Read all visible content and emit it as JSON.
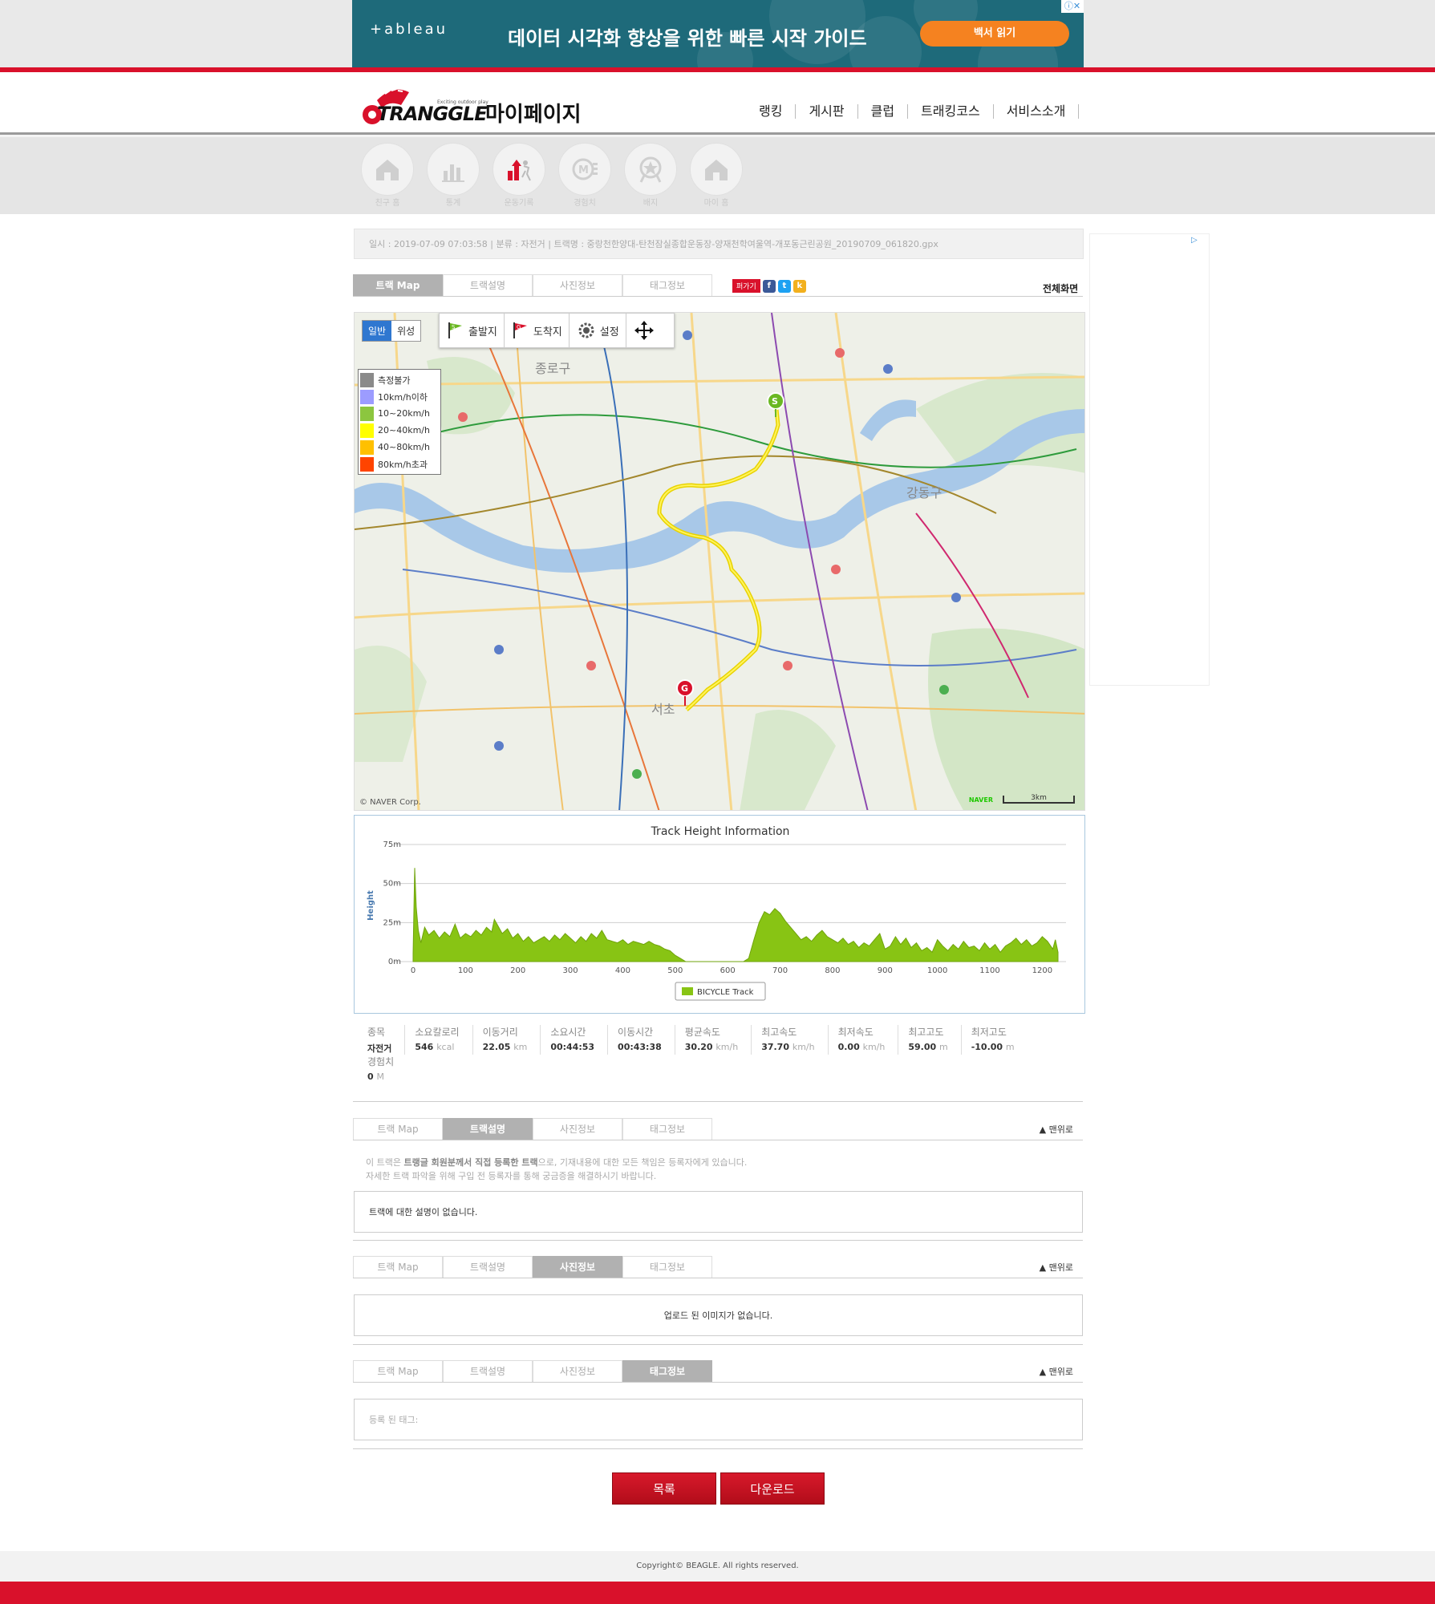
{
  "ad": {
    "brand": "+ableau",
    "headline": "데이터 시각화 향상을 위한 빠른 시작 가이드",
    "button": "백서 읽기"
  },
  "header": {
    "logo_text": "TRANGGLE",
    "slogan": "Exciting outdoor play",
    "page_title": "마이페이지",
    "nav": [
      "랭킹",
      "게시판",
      "클럽",
      "트래킹코스",
      "서비스소개"
    ]
  },
  "subnav": [
    "친구 홈",
    "통계",
    "운동기록",
    "경험치",
    "배지",
    "마이 홈"
  ],
  "info": "일시 : 2019-07-09 07:03:58   |   분류 : 자전거   |   트랙명 : 중랑천한양대-탄천잠실종합운동장-양재천학여울역-개포동근린공원_20190709_061820.gpx",
  "tabs": [
    "트랙 Map",
    "트랙설명",
    "사진정보",
    "태그정보"
  ],
  "share_label": "퍼가기",
  "fullscreen": "전체화면",
  "to_top": "맨위로",
  "map": {
    "toggle": [
      "일반",
      "위성"
    ],
    "tools": [
      "출발지",
      "도착지",
      "설정"
    ],
    "legend": [
      {
        "label": "측정불가",
        "color": "#8a8a8a"
      },
      {
        "label": "10km/h이하",
        "color": "#9c9cff"
      },
      {
        "label": "10~20km/h",
        "color": "#8cc63f"
      },
      {
        "label": "20~40km/h",
        "color": "#ffff00"
      },
      {
        "label": "40~80km/h",
        "color": "#ffc000"
      },
      {
        "label": "80km/h초과",
        "color": "#ff4400"
      }
    ],
    "labels": [
      "종로구",
      "강동구",
      "서초"
    ],
    "copyright": "© NAVER Corp.",
    "naver": "NAVER",
    "scale": "3km"
  },
  "chart_data": {
    "type": "area",
    "title": "Track Height Information",
    "ylabel": "Height",
    "xlabel": "",
    "xlim": [
      0,
      1230
    ],
    "ylim": [
      0,
      75
    ],
    "x_ticks": [
      0,
      100,
      200,
      300,
      400,
      500,
      600,
      700,
      800,
      900,
      1000,
      1100,
      1200
    ],
    "y_ticks": [
      "0m",
      "25m",
      "50m",
      "75m"
    ],
    "series": [
      {
        "name": "BICYCLE Track",
        "color": "#88c414",
        "points": [
          [
            0,
            5
          ],
          [
            3,
            60
          ],
          [
            6,
            35
          ],
          [
            10,
            20
          ],
          [
            15,
            12
          ],
          [
            22,
            22
          ],
          [
            30,
            17
          ],
          [
            40,
            20
          ],
          [
            50,
            15
          ],
          [
            60,
            19
          ],
          [
            70,
            16
          ],
          [
            80,
            24
          ],
          [
            90,
            15
          ],
          [
            100,
            18
          ],
          [
            110,
            16
          ],
          [
            120,
            20
          ],
          [
            130,
            17
          ],
          [
            140,
            22
          ],
          [
            150,
            19
          ],
          [
            155,
            27
          ],
          [
            160,
            24
          ],
          [
            170,
            18
          ],
          [
            180,
            21
          ],
          [
            190,
            15
          ],
          [
            200,
            18
          ],
          [
            210,
            13
          ],
          [
            220,
            16
          ],
          [
            230,
            12
          ],
          [
            240,
            14
          ],
          [
            250,
            16
          ],
          [
            260,
            13
          ],
          [
            270,
            17
          ],
          [
            280,
            14
          ],
          [
            290,
            18
          ],
          [
            300,
            15
          ],
          [
            310,
            12
          ],
          [
            320,
            16
          ],
          [
            330,
            13
          ],
          [
            340,
            18
          ],
          [
            350,
            15
          ],
          [
            360,
            20
          ],
          [
            370,
            14
          ],
          [
            380,
            13
          ],
          [
            390,
            12
          ],
          [
            400,
            14
          ],
          [
            410,
            11
          ],
          [
            420,
            13
          ],
          [
            430,
            12
          ],
          [
            440,
            11
          ],
          [
            450,
            13
          ],
          [
            460,
            11
          ],
          [
            470,
            10
          ],
          [
            480,
            8
          ],
          [
            490,
            7
          ],
          [
            500,
            4
          ],
          [
            510,
            2
          ],
          [
            520,
            0
          ],
          [
            530,
            -2
          ],
          [
            540,
            -4
          ],
          [
            550,
            -5
          ],
          [
            560,
            -6
          ],
          [
            570,
            -7
          ],
          [
            580,
            -8
          ],
          [
            590,
            -9
          ],
          [
            600,
            -10
          ],
          [
            610,
            -10
          ],
          [
            620,
            -8
          ],
          [
            630,
            -4
          ],
          [
            640,
            2
          ],
          [
            650,
            14
          ],
          [
            660,
            25
          ],
          [
            670,
            32
          ],
          [
            680,
            30
          ],
          [
            690,
            34
          ],
          [
            700,
            31
          ],
          [
            710,
            26
          ],
          [
            720,
            22
          ],
          [
            730,
            18
          ],
          [
            740,
            14
          ],
          [
            750,
            16
          ],
          [
            760,
            13
          ],
          [
            770,
            17
          ],
          [
            780,
            20
          ],
          [
            790,
            16
          ],
          [
            800,
            14
          ],
          [
            810,
            12
          ],
          [
            820,
            15
          ],
          [
            830,
            11
          ],
          [
            840,
            13
          ],
          [
            850,
            9
          ],
          [
            860,
            12
          ],
          [
            870,
            10
          ],
          [
            880,
            14
          ],
          [
            890,
            18
          ],
          [
            900,
            8
          ],
          [
            910,
            10
          ],
          [
            920,
            16
          ],
          [
            930,
            11
          ],
          [
            940,
            15
          ],
          [
            950,
            9
          ],
          [
            960,
            12
          ],
          [
            970,
            7
          ],
          [
            980,
            9
          ],
          [
            990,
            6
          ],
          [
            1000,
            14
          ],
          [
            1010,
            10
          ],
          [
            1020,
            7
          ],
          [
            1030,
            11
          ],
          [
            1040,
            8
          ],
          [
            1050,
            13
          ],
          [
            1060,
            9
          ],
          [
            1070,
            10
          ],
          [
            1080,
            7
          ],
          [
            1090,
            12
          ],
          [
            1100,
            8
          ],
          [
            1110,
            11
          ],
          [
            1120,
            6
          ],
          [
            1130,
            10
          ],
          [
            1140,
            12
          ],
          [
            1150,
            15
          ],
          [
            1160,
            11
          ],
          [
            1170,
            14
          ],
          [
            1180,
            10
          ],
          [
            1190,
            12
          ],
          [
            1200,
            16
          ],
          [
            1210,
            13
          ],
          [
            1220,
            8
          ],
          [
            1225,
            14
          ],
          [
            1230,
            6
          ]
        ]
      }
    ],
    "legend": "bottom-center"
  },
  "stats": [
    {
      "label": "종목",
      "value": "자전거",
      "unit": ""
    },
    {
      "label": "소요칼로리",
      "value": "546",
      "unit": "kcal"
    },
    {
      "label": "이동거리",
      "value": "22.05",
      "unit": "km"
    },
    {
      "label": "소요시간",
      "value": "00:44:53",
      "unit": ""
    },
    {
      "label": "이동시간",
      "value": "00:43:38",
      "unit": ""
    },
    {
      "label": "평균속도",
      "value": "30.20",
      "unit": "km/h"
    },
    {
      "label": "최고속도",
      "value": "37.70",
      "unit": "km/h"
    },
    {
      "label": "최저속도",
      "value": "0.00",
      "unit": "km/h"
    },
    {
      "label": "최고고도",
      "value": "59.00",
      "unit": "m"
    },
    {
      "label": "최저고도",
      "value": "-10.00",
      "unit": "m"
    }
  ],
  "exp": {
    "label": "경험치",
    "value": "0",
    "unit": "M"
  },
  "notice": {
    "line1_prefix": "이 트랙은 ",
    "line1_bold": "트랭글 회원분께서 직접 등록한 트랙",
    "line1_suffix": "으로, 기재내용에 대한 모든 책임은 등록자에게 있습니다.",
    "line2": "자세한 트랙 파악을 위해 구입 전 등록자를 통해 궁금증을 해결하시기 바랍니다."
  },
  "desc_text": "트랙에 대한 설명이 없습니다.",
  "photo_text": "업로드 된 이미지가 없습니다.",
  "tag_text": "등록 된 태그:",
  "buttons": {
    "list": "목록",
    "download": "다운로드"
  },
  "footer": "Copyright© BEAGLE. All rights reserved."
}
